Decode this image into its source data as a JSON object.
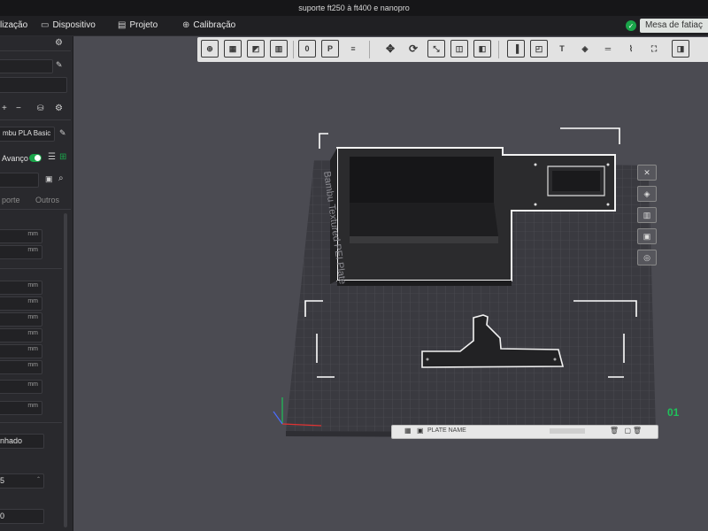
{
  "window": {
    "title": "suporte ft250 à ft400 e nanopro"
  },
  "menu": {
    "items": [
      {
        "label": "lização",
        "icon": ""
      },
      {
        "label": "Dispositivo",
        "icon": "monitor-icon"
      },
      {
        "label": "Projeto",
        "icon": "file-icon"
      },
      {
        "label": "Calibração",
        "icon": "calibration-icon"
      }
    ],
    "slice_label": "Mesa de fatiaç"
  },
  "sidebar": {
    "filament": "mbu PLA Basic",
    "advanced_label": "Avanço",
    "tabs": [
      "porte",
      "Outros"
    ],
    "units": [
      "mm",
      "mm",
      "mm",
      "mm",
      "mm",
      "mm",
      "mm",
      "mm",
      "mm",
      "mm"
    ],
    "pattern_value": "nhado",
    "number_value": "5",
    "zero_value": "0"
  },
  "viewport": {
    "plate_label": "Bambu Textured PEI Plate",
    "plate_number": "01",
    "plate_bar_text": "PLATE NAME"
  },
  "colors": {
    "accent_green": "#1aa54a",
    "viewport_bg": "#4b4b52",
    "plate": "#3a3a40"
  }
}
